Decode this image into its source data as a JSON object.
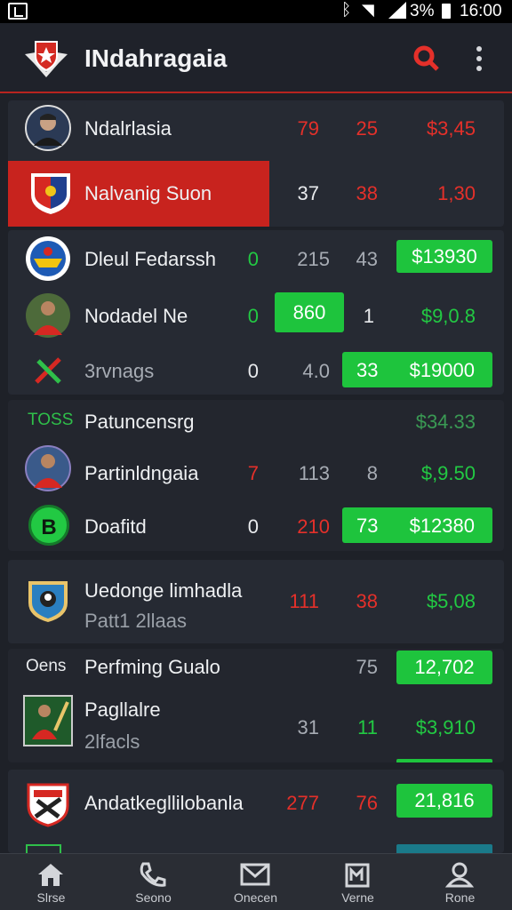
{
  "status_bar": {
    "battery": "3%",
    "time": "16:00",
    "icons": [
      "app-icon",
      "bluetooth-icon",
      "wifi-icon",
      "signal-icon",
      "battery-icon"
    ]
  },
  "app_bar": {
    "title": "INdahragaia",
    "search_icon": "search-icon",
    "more_icon": "more-icon"
  },
  "colors": {
    "accent": "#b8241f",
    "positive": "#1ec43d",
    "negative": "#e4302a",
    "background": "#1e2128",
    "card": "#262a33"
  },
  "card1": {
    "rows": [
      {
        "name": "Ndalrlasia",
        "v1": "79",
        "v2": "25",
        "v3": "$3,45"
      },
      {
        "name": "Nalvanig Suon",
        "v1": "37",
        "v2": "38",
        "v3": "1,30"
      }
    ]
  },
  "card2": {
    "rows": [
      {
        "name": "Dleul Fedarssh",
        "v1": "0",
        "v2": "215",
        "v3": "43",
        "v4": "$13930"
      },
      {
        "name": "Nodadel Ne",
        "v1": "0",
        "v2": "860",
        "v3": "1",
        "v4": "$9,0.8"
      },
      {
        "name": "3rvnags",
        "v1": "0",
        "v2": "4.0",
        "v3": "33",
        "v4": "$19000"
      }
    ]
  },
  "card3": {
    "tag": "TOSS",
    "rows": [
      {
        "name": "Patuncensrg",
        "v4": "$34.33"
      },
      {
        "name": "Partinldngaia",
        "v1": "7",
        "v2": "113",
        "v3": "8",
        "v4": "$,9.50"
      },
      {
        "name": "Doafitd",
        "badge": "B",
        "v1": "0",
        "v2": "210",
        "v3": "73",
        "v4": "$12380"
      }
    ]
  },
  "card4": {
    "name": "Uedonge limhadla",
    "sub": "Patt1 2llaas",
    "v1": "111",
    "v2": "38",
    "v3": "$5,08"
  },
  "card5": {
    "tag": "Oens",
    "rows": [
      {
        "name": "Perfming Gualo",
        "v1": "75",
        "v2": "12,702"
      },
      {
        "name": "Pagllalre",
        "sub": "2lfacls",
        "v1": "31",
        "v2": "11",
        "v3": "$3,910"
      }
    ]
  },
  "card6": {
    "name": "Andatkegllilobanla",
    "v1": "277",
    "v2": "76",
    "v3": "21,816"
  },
  "bottom_nav": [
    {
      "label": "Slrse",
      "icon": "home-icon"
    },
    {
      "label": "Seono",
      "icon": "phone-icon"
    },
    {
      "label": "Onecen",
      "icon": "mail-icon"
    },
    {
      "label": "Verne",
      "icon": "book-icon"
    },
    {
      "label": "Rone",
      "icon": "profile-icon"
    }
  ]
}
